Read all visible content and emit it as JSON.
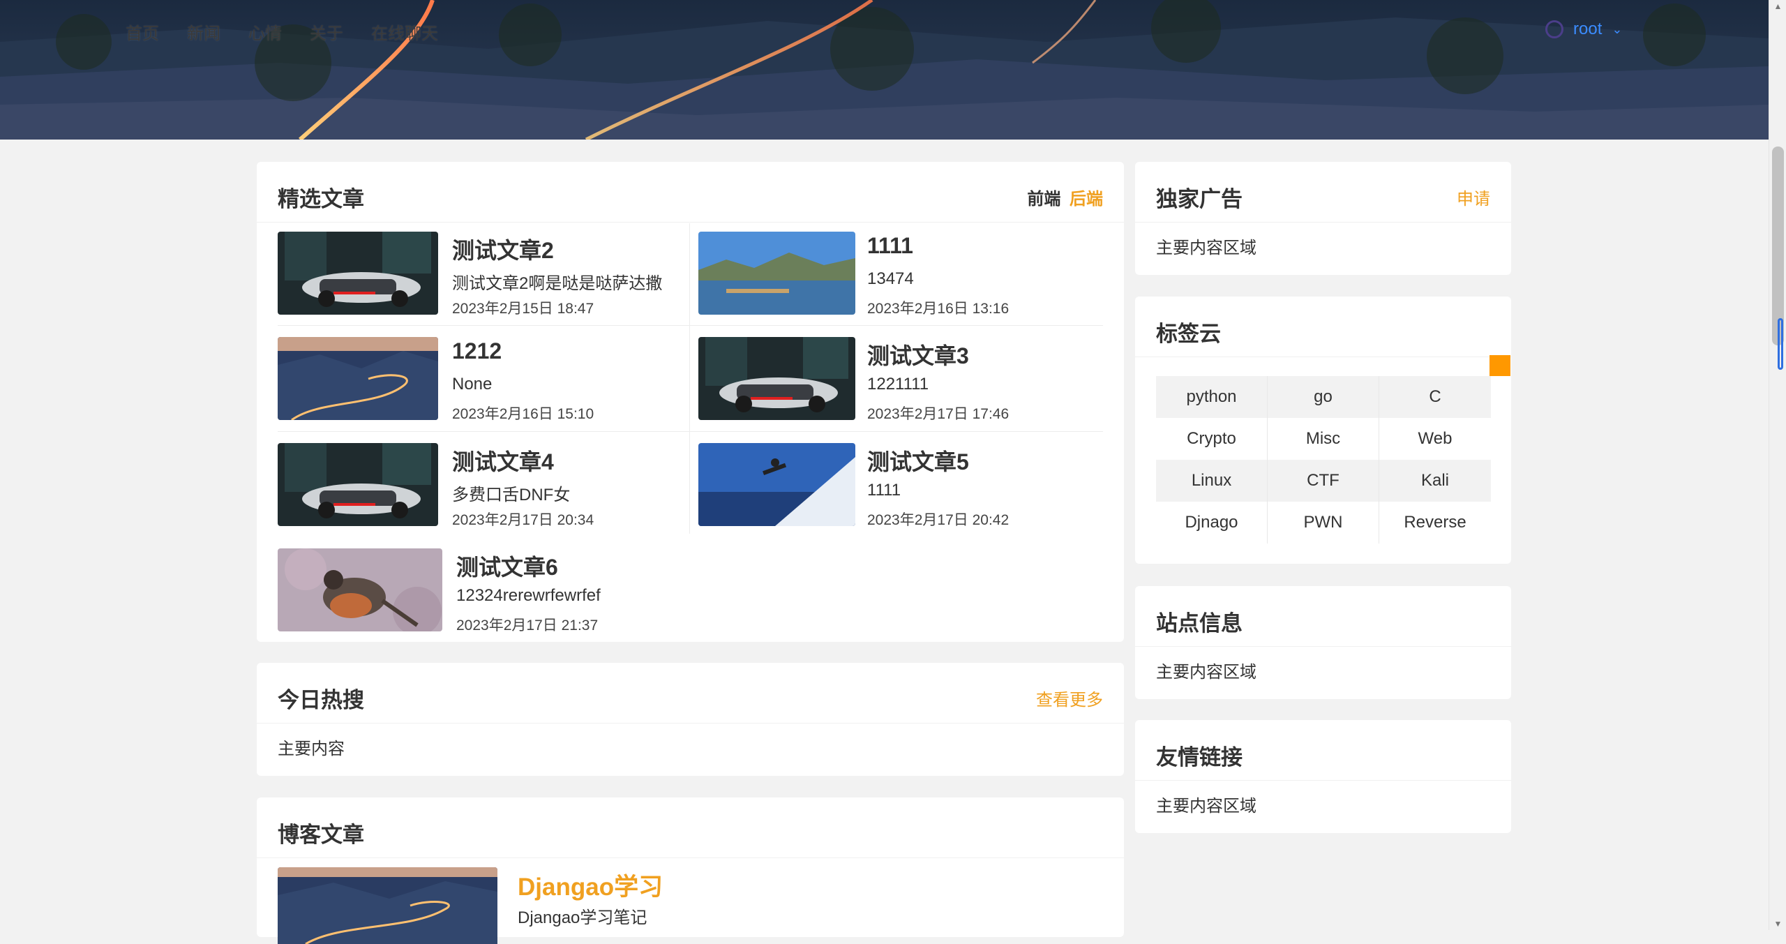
{
  "nav": {
    "items": [
      "首页",
      "新闻",
      "心情",
      "关于",
      "在线聊天"
    ],
    "user_name": "root",
    "user_menu_icon": "chevron-down-icon"
  },
  "featured": {
    "title": "精选文章",
    "tabs": [
      {
        "label": "前端",
        "active": false
      },
      {
        "label": "后端",
        "active": true
      }
    ],
    "articles": [
      {
        "title": "测试文章2",
        "summary": "测试文章2啊是哒是哒萨达撒",
        "date": "2023年2月15日 18:47",
        "image": "sports-car"
      },
      {
        "title": "1111",
        "summary": "13474",
        "date": "2023年2月16日 13:16",
        "image": "mountain-lake"
      },
      {
        "title": "1212",
        "summary": "None",
        "date": "2023年2月16日 15:10",
        "image": "mountain-road"
      },
      {
        "title": "测试文章3",
        "summary": "1221111",
        "date": "2023年2月17日 17:46",
        "image": "sports-car"
      },
      {
        "title": "测试文章4",
        "summary": "多费口舌DNF女",
        "date": "2023年2月17日 20:34",
        "image": "sports-car"
      },
      {
        "title": "测试文章5",
        "summary": "1111",
        "date": "2023年2月17日 20:42",
        "image": "snowboarder"
      },
      {
        "title": "测试文章6",
        "summary": "12324rerewrfewrfef",
        "date": "2023年2月17日 21:37",
        "image": "robin-bird"
      }
    ]
  },
  "hot": {
    "title": "今日热搜",
    "more": "查看更多",
    "body": "主要内容"
  },
  "blog": {
    "title": "博客文章",
    "article": {
      "title": "Djangao学习",
      "summary": "Djangao学习笔记",
      "image": "mountain-road"
    }
  },
  "ad": {
    "title": "独家广告",
    "apply": "申请",
    "body": "主要内容区域"
  },
  "tags": {
    "title": "标签云",
    "items": [
      "python",
      "go",
      "C",
      "Crypto",
      "Misc",
      "Web",
      "Linux",
      "CTF",
      "Kali",
      "Djnago",
      "PWN",
      "Reverse"
    ]
  },
  "site": {
    "title": "站点信息",
    "body": "主要内容区域"
  },
  "links": {
    "title": "友情链接",
    "body": "主要内容区域"
  },
  "colors": {
    "accent": "#f0a020",
    "link_blue": "#3b8cff",
    "tag_badge": "#ff9800"
  }
}
